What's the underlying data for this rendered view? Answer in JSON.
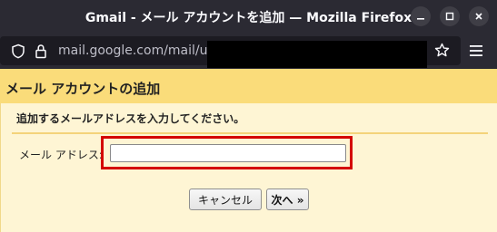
{
  "window": {
    "title": "Gmail - メール アカウントを追加 — Mozilla Firefox"
  },
  "browser": {
    "url_visible": "mail.google.com/mail/u"
  },
  "page": {
    "heading": "メール アカウントの追加",
    "instruction": "追加するメールアドレスを入力してください。",
    "email_label": "メール アドレス:",
    "email_value": "",
    "cancel_label": "キャンセル",
    "next_label": "次へ »"
  },
  "colors": {
    "header_band": "#fadc7a",
    "panel_bg": "#fef5d4",
    "highlight_border": "#d40000",
    "titlebar_bg": "#2b2a33"
  },
  "icons": [
    "shield-icon",
    "lock-icon",
    "star-icon",
    "menu-icon",
    "minimize-icon",
    "maximize-icon",
    "close-icon"
  ]
}
